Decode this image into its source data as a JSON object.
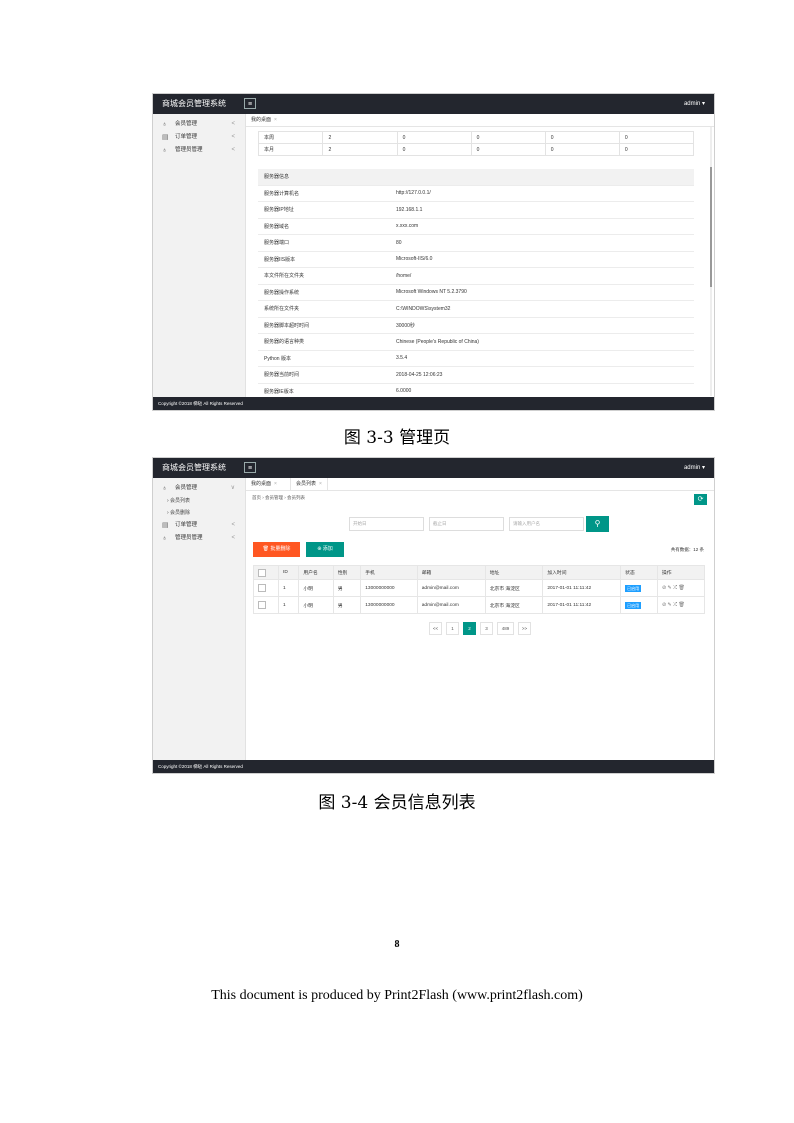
{
  "app": {
    "title": "商城会员管理系统",
    "user": "admin ▾",
    "menu_icon": "≡",
    "footer": "Copyright ©2018 梯哒 All Rights Reserved"
  },
  "shot1": {
    "sidebar": [
      {
        "icon": "user-icon",
        "glyph": "♁",
        "label": "会员管理",
        "arrow": "<"
      },
      {
        "icon": "order-icon",
        "glyph": "▤",
        "label": "订单管理",
        "arrow": "<"
      },
      {
        "icon": "admin-icon",
        "glyph": "♁",
        "label": "管理员管理",
        "arrow": "<"
      }
    ],
    "tabs": [
      {
        "label": "我的桌面",
        "close": "×"
      }
    ],
    "stats_rows": [
      [
        "本周",
        "2",
        "0",
        "0",
        "0",
        "0"
      ],
      [
        "本月",
        "2",
        "0",
        "0",
        "0",
        "0"
      ]
    ],
    "server_header": "服务器信息",
    "server_rows": [
      [
        "服务器计算机名",
        "http://127.0.0.1/"
      ],
      [
        "服务器IP地址",
        "192.168.1.1"
      ],
      [
        "服务器域名",
        "x.xxx.com"
      ],
      [
        "服务器端口",
        "80"
      ],
      [
        "服务器IIS版本",
        "Microsoft-IIS/6.0"
      ],
      [
        "本文件所在文件夹",
        "/home/"
      ],
      [
        "服务器操作系统",
        "Microsoft Windows NT 5.2.3790"
      ],
      [
        "系统所在文件夹",
        "C:\\WINDOWS\\system32"
      ],
      [
        "服务器脚本超时时间",
        "30000秒"
      ],
      [
        "服务器的语言种类",
        "Chinese (People's Republic of China)"
      ],
      [
        "Python 版本",
        "3.5.4"
      ],
      [
        "服务器当前时间",
        "2018-04-25 12:06:23"
      ],
      [
        "服务器IE版本",
        "6.0000"
      ]
    ]
  },
  "caption1": "图 3-3 管理页",
  "shot2": {
    "sidebar_main": {
      "icon": "user-icon",
      "glyph": "♁",
      "label": "会员管理",
      "arrow": "∨"
    },
    "sidebar_subs": [
      "› 会员列表",
      "› 会员删除"
    ],
    "sidebar_rest": [
      {
        "icon": "order-icon",
        "glyph": "▤",
        "label": "订单管理",
        "arrow": "<"
      },
      {
        "icon": "admin-icon",
        "glyph": "♁",
        "label": "管理员管理",
        "arrow": "<"
      }
    ],
    "tabs": [
      {
        "label": "我的桌面",
        "close": "×"
      },
      {
        "label": "会员列表",
        "close": "×"
      }
    ],
    "breadcrumb": "首页 › 会员管理 › 会员列表",
    "refresh_icon": "⟳",
    "search": {
      "start_placeholder": "开始日",
      "end_placeholder": "截止日",
      "name_placeholder": "请输入用户名",
      "button": "⚲"
    },
    "batch_delete": "🗑 批量删除",
    "add": "⊕ 添加",
    "total": "共有数据：12 条",
    "columns": [
      "",
      "ID",
      "用户名",
      "性别",
      "手机",
      "邮箱",
      "地址",
      "加入时间",
      "状态",
      "操作"
    ],
    "rows": [
      {
        "id": "1",
        "name": "小明",
        "gender": "男",
        "phone": "13000000000",
        "email": "admin@mail.com",
        "address": "北京市 海淀区",
        "joined": "2017-01-01 11:11:42",
        "status": "已启用",
        "ops": "⊘ ✎ ⤮ 🗑"
      },
      {
        "id": "1",
        "name": "小明",
        "gender": "男",
        "phone": "13000000000",
        "email": "admin@mail.com",
        "address": "北京市 海淀区",
        "joined": "2017-01-01 11:11:42",
        "status": "已启用",
        "ops": "⊘ ✎ ⤮ 🗑"
      }
    ],
    "pager": [
      "<<",
      "1",
      "2",
      "3",
      "489",
      ">>"
    ],
    "pager_current": 2
  },
  "caption2": "图 3-4 会员信息列表",
  "page_number": "8",
  "producer": "This document is produced by Print2Flash (www.print2flash.com)"
}
